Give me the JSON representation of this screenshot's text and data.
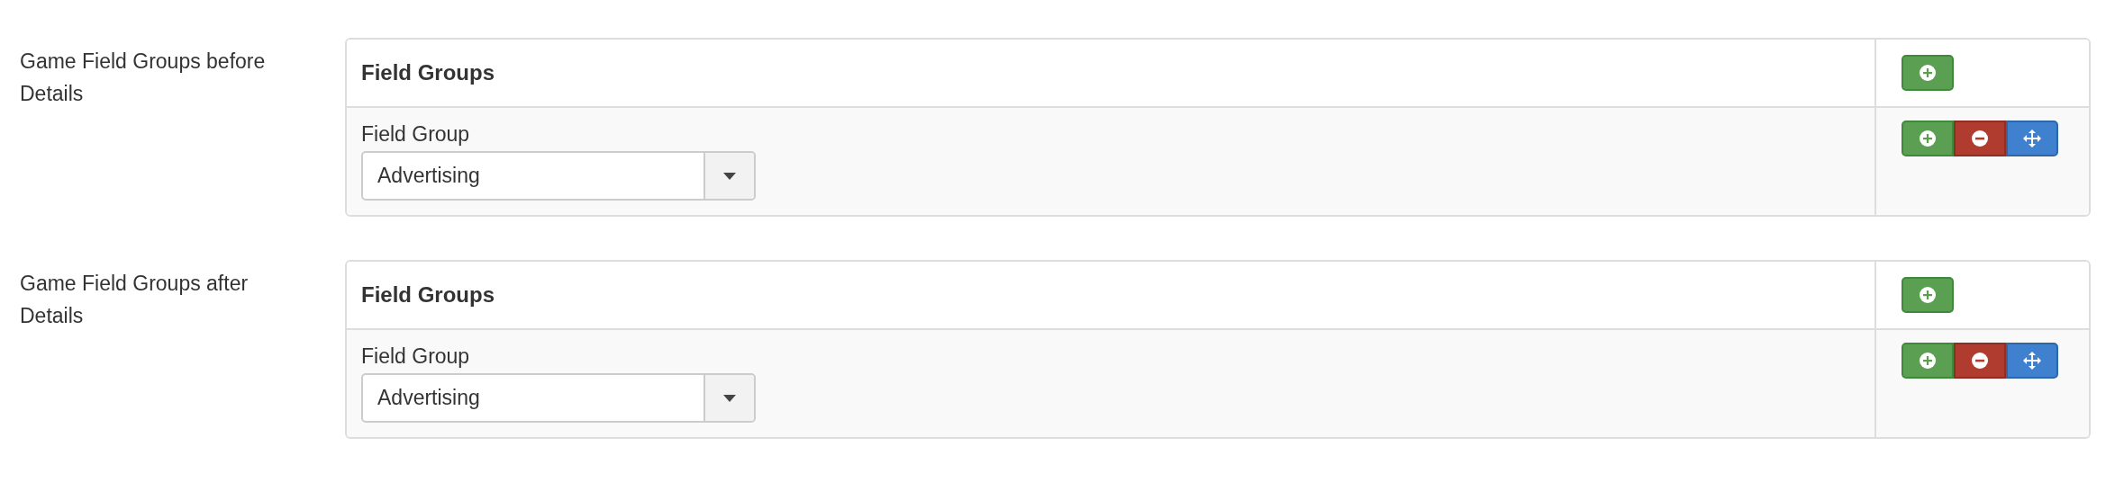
{
  "sections": [
    {
      "label": "Game Field Groups before Details",
      "table": {
        "header": "Field Groups",
        "rows": [
          {
            "field_label": "Field Group",
            "select_value": "Advertising"
          }
        ]
      }
    },
    {
      "label": "Game Field Groups after Details",
      "table": {
        "header": "Field Groups",
        "rows": [
          {
            "field_label": "Field Group",
            "select_value": "Advertising"
          }
        ]
      }
    }
  ]
}
